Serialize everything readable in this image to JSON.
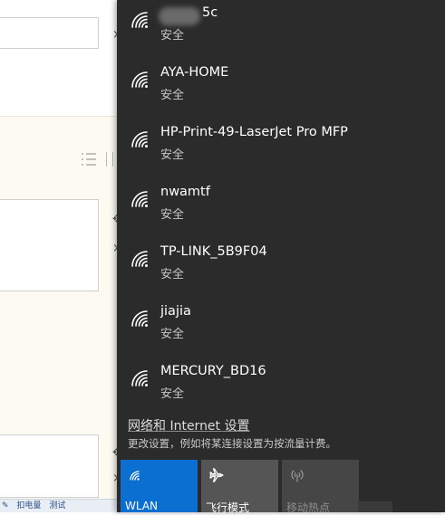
{
  "background_app": {
    "taskbar_items": [
      "扣电量",
      "测试"
    ]
  },
  "networks": [
    {
      "name": "5c",
      "status": "安全",
      "redacted_prefix": true
    },
    {
      "name": "AYA-HOME",
      "status": "安全"
    },
    {
      "name": "HP-Print-49-LaserJet Pro MFP",
      "status": "安全"
    },
    {
      "name": "nwamtf",
      "status": "安全"
    },
    {
      "name": "TP-LINK_5B9F04",
      "status": "安全"
    },
    {
      "name": "jiajia",
      "status": "安全"
    },
    {
      "name": "MERCURY_BD16",
      "status": "安全"
    }
  ],
  "settings": {
    "link_label": "网络和 Internet 设置",
    "description": "更改设置，例如将某连接设置为按流量计费。"
  },
  "quick_actions": {
    "wlan": {
      "label": "WLAN",
      "icon": "wifi-icon",
      "state": "on"
    },
    "airplane": {
      "label": "飞行模式",
      "icon": "airplane-icon",
      "state": "off"
    },
    "hotspot": {
      "label": "移动热点",
      "icon": "hotspot-icon",
      "state": "disabled"
    }
  },
  "colors": {
    "flyout_background": "#2b2b2b",
    "accent": "#0a6fd0",
    "tile_inactive": "#555555",
    "tile_disabled": "#464646"
  }
}
